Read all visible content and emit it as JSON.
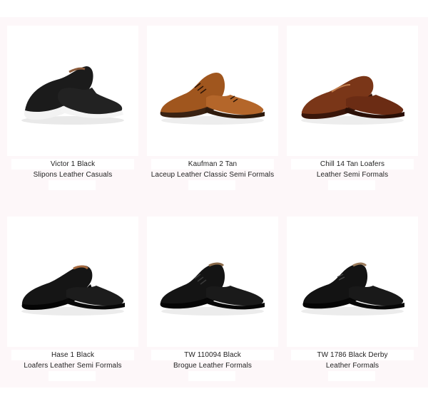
{
  "products": [
    {
      "name": "Victor 1 Black",
      "desc": "Slipons Leather Casuals",
      "icon": "slipon-shoe-icon",
      "color": "#1b1b1b"
    },
    {
      "name": "Kaufman 2 Tan",
      "desc": "Laceup Leather Classic Semi Formals",
      "icon": "brogue-shoe-icon",
      "color": "#a0561e"
    },
    {
      "name": "Chill 14 Tan Loafers",
      "desc": "Leather Semi Formals",
      "icon": "loafer-shoe-icon",
      "color": "#6e2f17"
    },
    {
      "name": "Hase 1 Black",
      "desc": "Loafers Leather Semi Formals",
      "icon": "loafer-shoe-icon",
      "color": "#151515"
    },
    {
      "name": "TW 110094 Black",
      "desc": "Brogue Leather Formals",
      "icon": "brogue-shoe-icon",
      "color": "#111111"
    },
    {
      "name": "TW 1786 Black Derby",
      "desc": "Leather Formals",
      "icon": "derby-shoe-icon",
      "color": "#121212"
    }
  ]
}
